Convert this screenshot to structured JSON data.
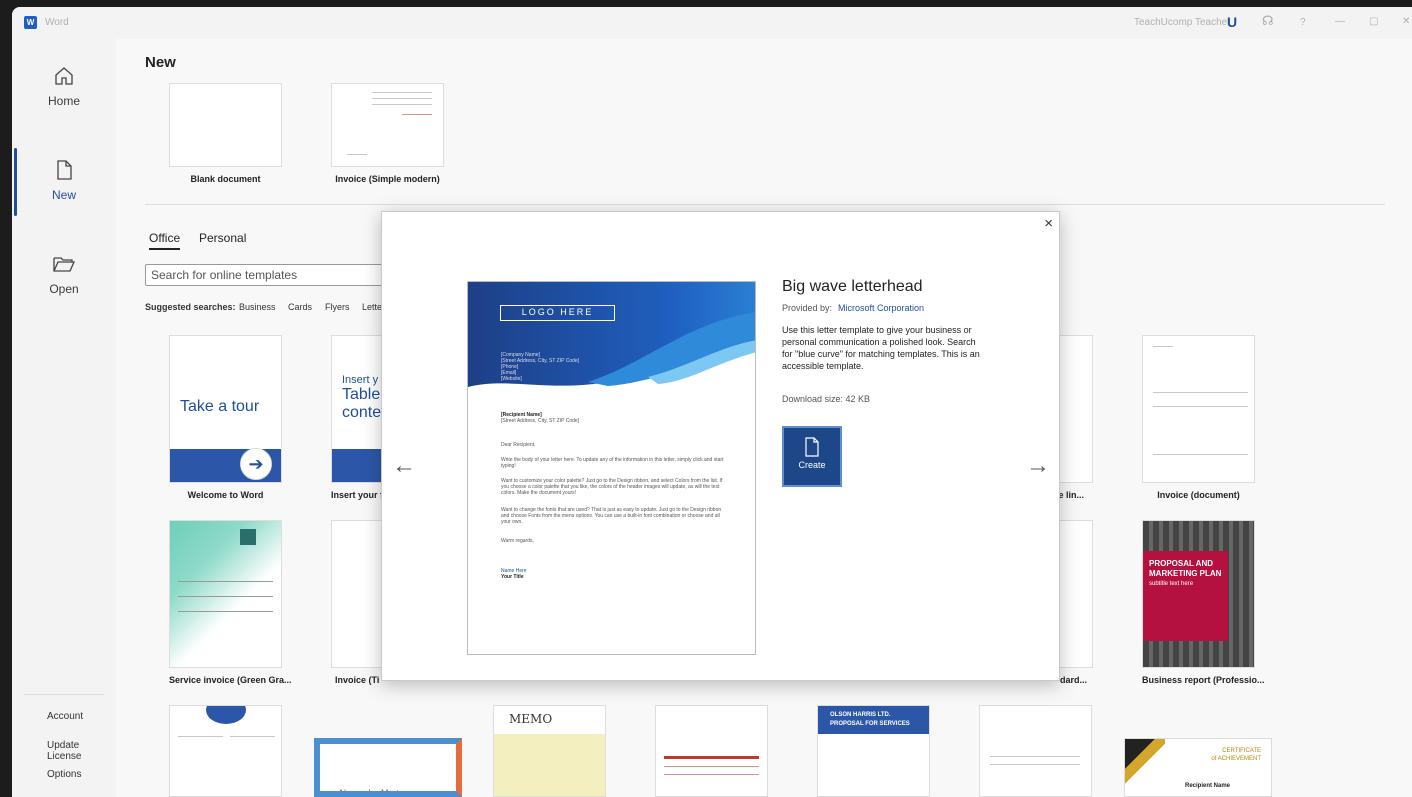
{
  "titlebar": {
    "app_name": "Word",
    "user": "TeachUcomp Teacher",
    "user_initial": "U",
    "help": "?",
    "minimize": "—",
    "restore": "▢",
    "close": "✕"
  },
  "sidebar": {
    "home": "Home",
    "new": "New",
    "open": "Open",
    "account": "Account",
    "update_license": "Update License",
    "options": "Options"
  },
  "main": {
    "heading": "New",
    "top_templates": [
      "Blank document",
      "Invoice (Simple modern)"
    ],
    "tabs": [
      "Office",
      "Personal"
    ],
    "search_placeholder": "Search for online templates",
    "suggested_label": "Suggested searches:",
    "suggested": [
      "Business",
      "Cards",
      "Flyers",
      "Lette"
    ],
    "grid_row1": [
      "Welcome to Word",
      "Insert your fi",
      "le lin...",
      "Invoice (document)"
    ],
    "grid_row2": [
      "Service invoice (Green Gra...",
      "Invoice (Ti",
      "dard...",
      "Business report (Professio..."
    ],
    "tour_text": "Take a tour",
    "insert_text": [
      "Insert y",
      "Table",
      "conte"
    ],
    "proposal_text": [
      "PROPOSAL AND",
      "MARKETING PLAN",
      "subtitle text here"
    ],
    "memo_text": "MEMO",
    "olson_text": [
      "OLSON HARRIS LTD.",
      "PROPOSAL FOR SERVICES"
    ],
    "cert_text": [
      "CERTIFICATE",
      "of ACHIEVEMENT",
      "Recipient Name"
    ],
    "employee_text": "Alexander Martensson"
  },
  "dialog": {
    "title": "Big wave letterhead",
    "provided_by_label": "Provided by:",
    "provider": "Microsoft Corporation",
    "description": "Use this letter template to give your business or personal communication a polished look. Search for \"blue curve\" for matching templates. This is an accessible template.",
    "download_size": "Download size:  42 KB",
    "create_label": "Create",
    "close": "×",
    "prev": "←",
    "next": "→",
    "preview": {
      "logo": "LOGO HERE",
      "company": [
        "[Company Name]",
        "[Street Address, City, ST ZIP Code]",
        "[Phone]",
        "[Email]",
        "[Website]"
      ],
      "recipient": [
        "[Recipient Name]",
        "[Street Address, City, ST ZIP Code]"
      ],
      "greeting": "Dear Recipient,",
      "body": [
        "Write the body of your letter here. To update any of the information in this letter, simply click and start typing!",
        "Want to customize your color palette? Just go to the Design ribbon, and select Colors from the list. If you choose a color palette that you like, the colors of the header images will update, as will the text colors. Make the document yours!",
        "Want to change the fonts that are used? That is just as easy to update. Just go to the Design ribbon and choose Fonts from the menu options. You can use a built-in font combination or choose and all your own."
      ],
      "closing": "Warm regards,",
      "name": "Name Here",
      "role": "Your Title"
    }
  },
  "colors": {
    "accent": "#1f4e9c",
    "create_bg": "#1d4788",
    "proposal_red": "#b5113e"
  }
}
